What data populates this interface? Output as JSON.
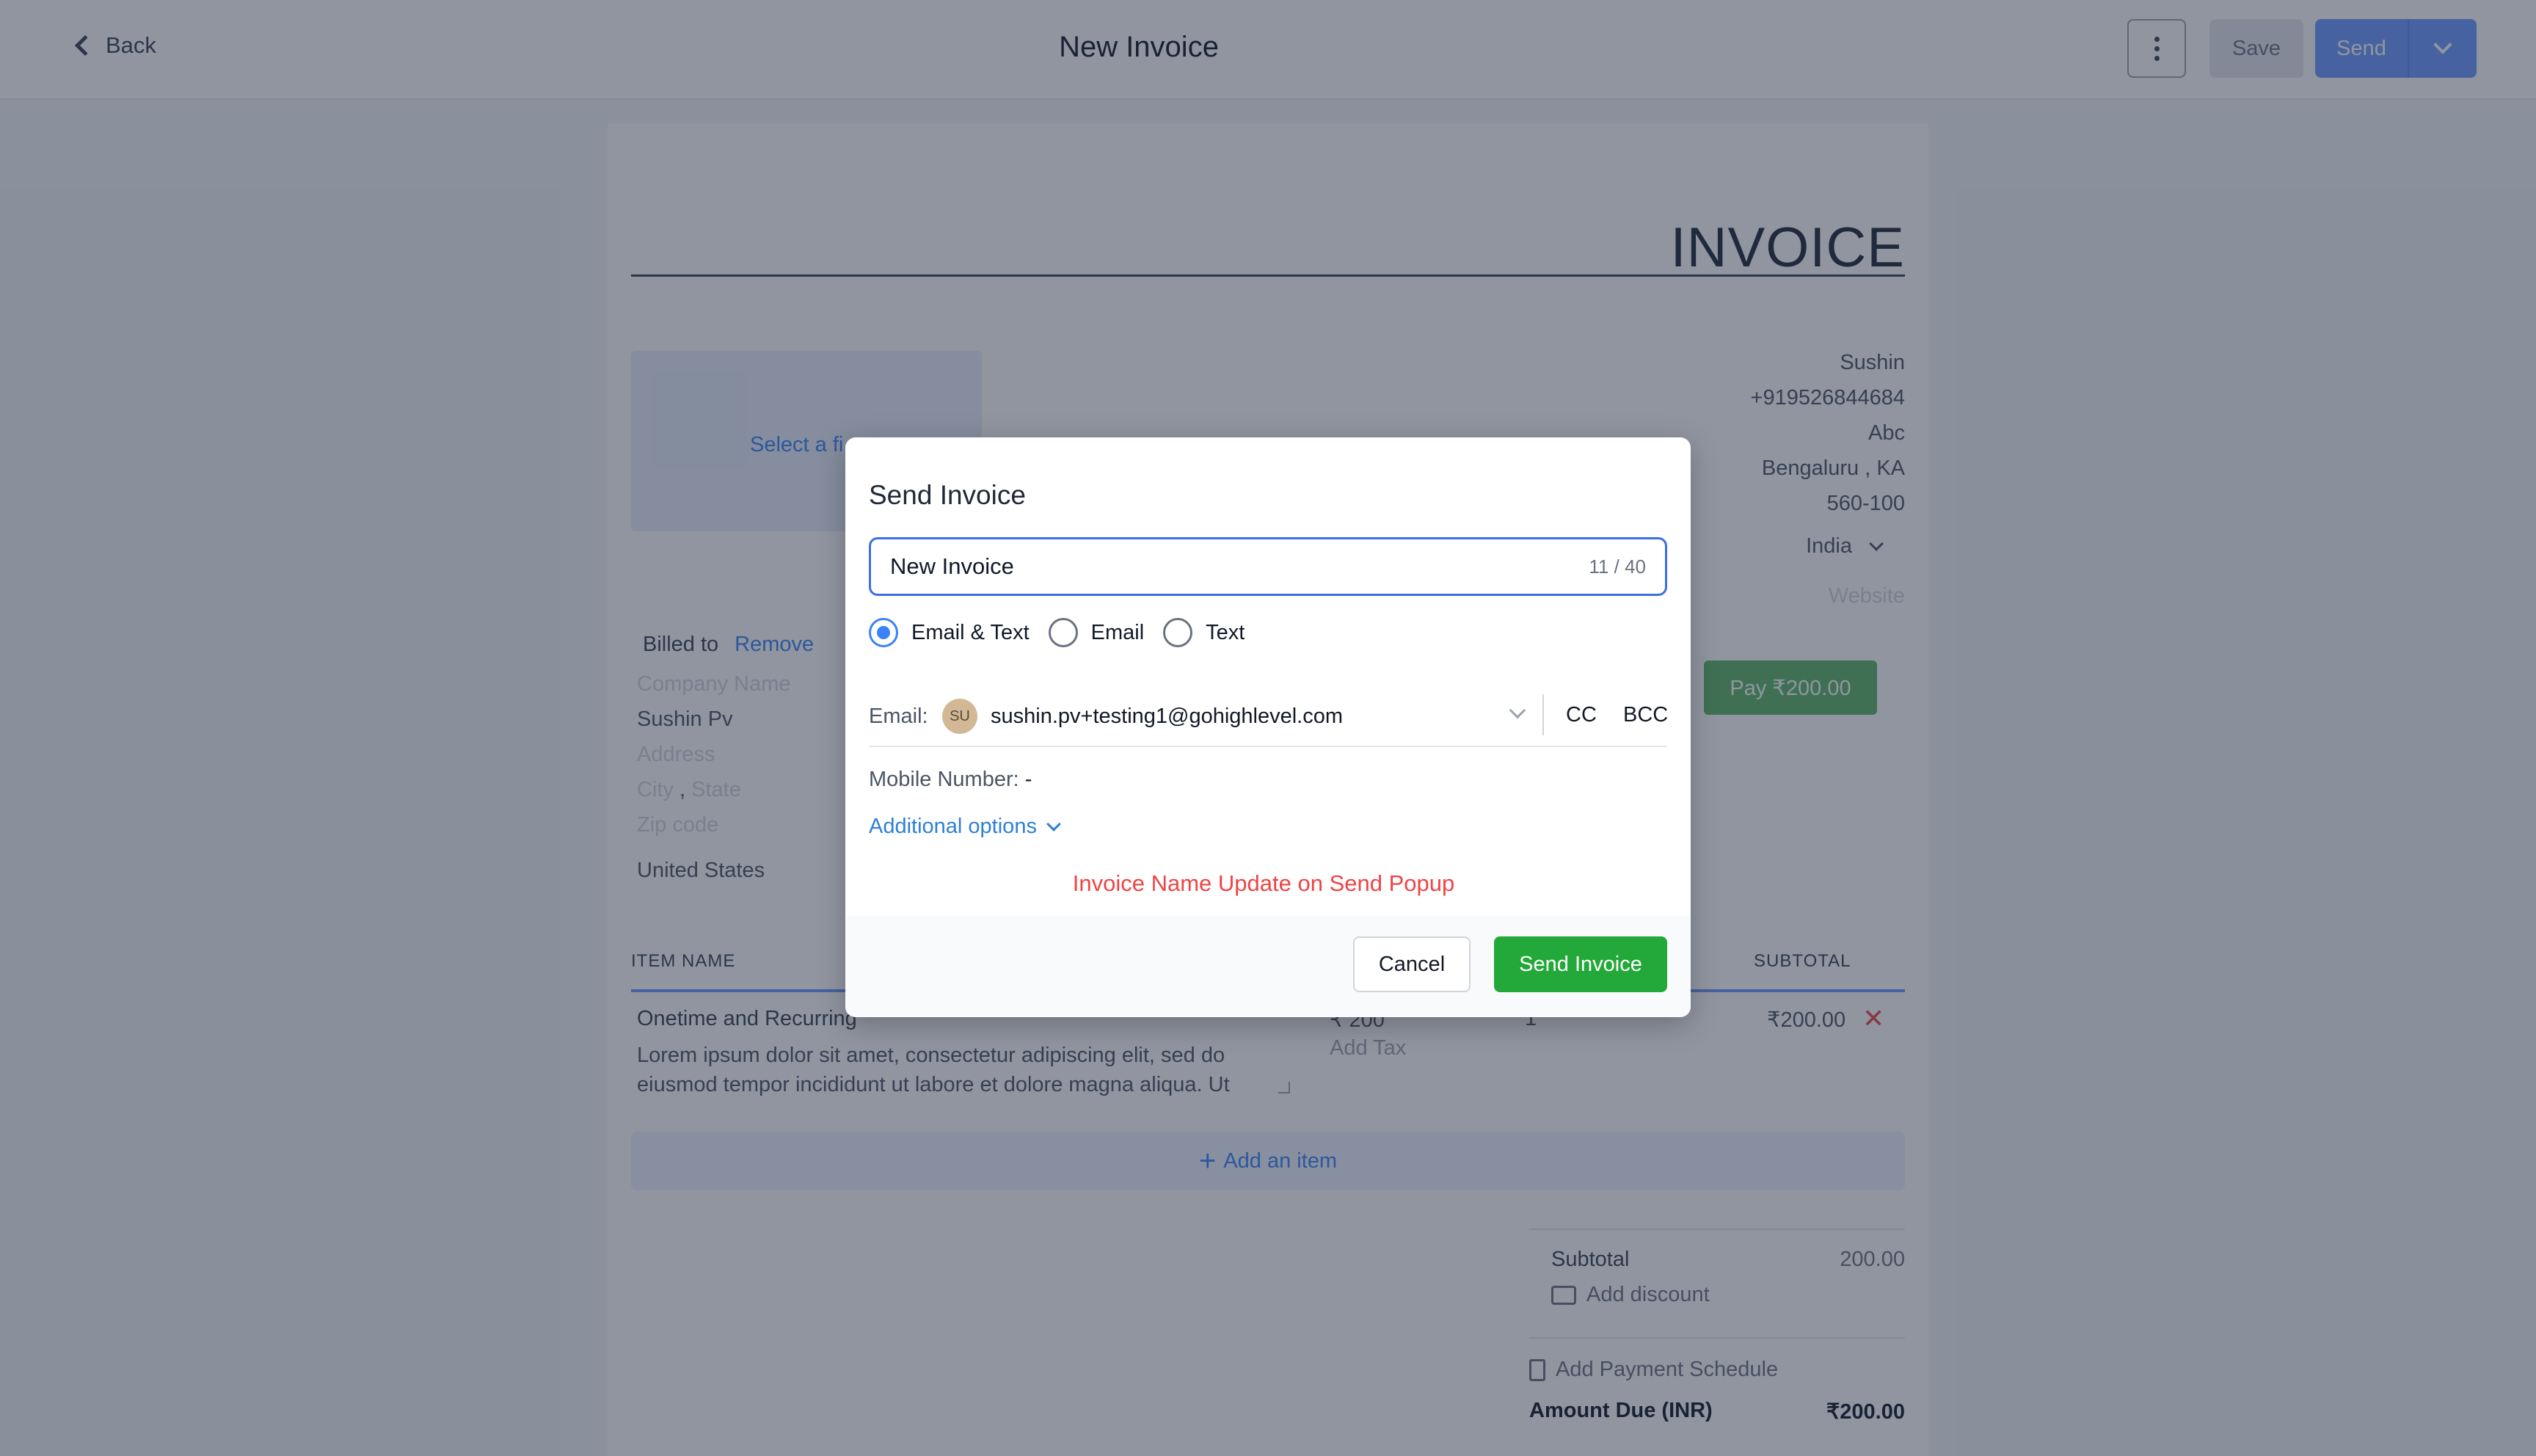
{
  "header": {
    "back_label": "Back",
    "title": "New Invoice",
    "more_icon": "kebab-vertical-icon",
    "save_label": "Save",
    "send_label": "Send"
  },
  "invoice": {
    "heading": "INVOICE",
    "logo_placeholder": "Select a fi",
    "business": {
      "name": "Sushin",
      "phone": "+919526844684",
      "address": "Abc",
      "city": "Bengaluru",
      "state": "KA",
      "zip": "560-100",
      "country": "India",
      "website_placeholder": "Website"
    },
    "pay_button": "Pay ₹200.00",
    "billed_to": {
      "label": "Billed to",
      "remove": "Remove",
      "company_placeholder": "Company Name",
      "name": "Sushin Pv",
      "address_placeholder": "Address",
      "city_placeholder": "City",
      "state_placeholder": "State",
      "zip_placeholder": "Zip code",
      "country": "United States"
    },
    "table": {
      "col_item": "ITEM NAME",
      "col_subtotal": "SUBTOTAL",
      "rows": [
        {
          "name": "Onetime and Recurring",
          "description": "Lorem ipsum dolor sit amet, consectetur adipiscing elit, sed do eiusmod tempor incididunt ut labore et dolore magna aliqua. Ut",
          "price": "₹  200",
          "add_tax": "Add Tax",
          "qty": "1",
          "subtotal": "₹200.00"
        }
      ],
      "add_item": "Add an item"
    },
    "totals": {
      "subtotal_label": "Subtotal",
      "subtotal_value": "200.00",
      "add_discount": "Add discount",
      "add_schedule": "Add Payment Schedule",
      "amount_due_label": "Amount Due (INR)",
      "amount_due_value": "₹200.00"
    }
  },
  "modal": {
    "title": "Send Invoice",
    "name_value": "New Invoice",
    "char_count": "11 / 40",
    "options": [
      {
        "label": "Email & Text",
        "selected": true
      },
      {
        "label": "Email",
        "selected": false
      },
      {
        "label": "Text",
        "selected": false
      }
    ],
    "email_label": "Email:",
    "avatar_initials": "SU",
    "email_value": "sushin.pv+testing1@gohighlevel.com",
    "cc": "CC",
    "bcc": "BCC",
    "mobile_label": "Mobile Number:",
    "mobile_value": "-",
    "additional_options": "Additional options",
    "note": "Invoice Name Update on Send Popup",
    "cancel": "Cancel",
    "send_invoice": "Send Invoice"
  },
  "colors": {
    "primary": "#6a98ff",
    "send_invoice": "#23a83a",
    "pay": "#5fb566",
    "note_red": "#ef4444"
  }
}
